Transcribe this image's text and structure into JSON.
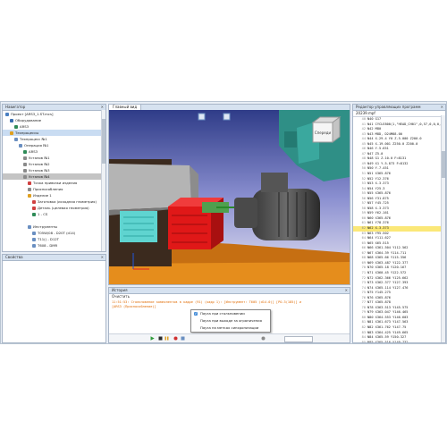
{
  "navigator": {
    "title": "Навигатор",
    "items": [
      {
        "label": "Проект [ARS3_1.ST.mcs]",
        "indent": 0,
        "icon": "#4a7fc1",
        "state": ""
      },
      {
        "label": "Оборудование",
        "indent": 1,
        "icon": "#3a6fb0",
        "state": ""
      },
      {
        "label": "ARS3",
        "indent": 2,
        "icon": "#2e8b57",
        "state": ""
      },
      {
        "label": "Техпроцессы",
        "indent": 1,
        "icon": "#e0a020",
        "state": "sel"
      },
      {
        "label": "Техпроцесс №1",
        "indent": 2,
        "icon": "#6a8fc1",
        "state": ""
      },
      {
        "label": "Операция №1",
        "indent": 3,
        "icon": "#6a8fc1",
        "state": ""
      },
      {
        "label": "ARS3",
        "indent": 4,
        "icon": "#2e8b57",
        "state": ""
      },
      {
        "label": "Установ №1",
        "indent": 4,
        "icon": "#8a8a8a",
        "state": ""
      },
      {
        "label": "Установ №2",
        "indent": 4,
        "icon": "#8a8a8a",
        "state": ""
      },
      {
        "label": "Установ №3",
        "indent": 4,
        "icon": "#8a8a8a",
        "state": ""
      },
      {
        "label": "Установ №4",
        "indent": 4,
        "icon": "#8a8a8a",
        "state": "hl"
      },
      {
        "label": "Точка привязки изделия",
        "indent": 5,
        "icon": "#d04040",
        "state": ""
      },
      {
        "label": "Приспособления",
        "indent": 5,
        "icon": "#8a8a8a",
        "state": ""
      },
      {
        "label": "Изделие 1",
        "indent": 5,
        "icon": "#e0a020",
        "state": ""
      },
      {
        "label": "Заготовка (исходная геометрия)",
        "indent": 6,
        "icon": "#d04040",
        "state": ""
      },
      {
        "label": "Деталь (целевая геометрия)",
        "indent": 6,
        "icon": "#d04040",
        "state": ""
      },
      {
        "label": "1 - CS",
        "indent": 6,
        "icon": "#2e8b57",
        "state": ""
      },
      {
        "label": "",
        "indent": 5,
        "icon": "",
        "state": ""
      },
      {
        "label": "Инструменты",
        "indent": 5,
        "icon": "#6a8fc1",
        "state": ""
      },
      {
        "label": "T05W/08 - D20T (d14)",
        "indent": 6,
        "icon": "#6a8fc1",
        "state": ""
      },
      {
        "label": "T11() - D12T",
        "indent": 6,
        "icon": "#6a8fc1",
        "state": ""
      },
      {
        "label": "T608 - DMR",
        "indent": 6,
        "icon": "#6a8fc1",
        "state": ""
      }
    ]
  },
  "properties": {
    "title": "Свойства"
  },
  "view": {
    "tab_label": "Главный вид",
    "cube_label": "Спереди"
  },
  "history": {
    "title": "История",
    "clear_label": "Очистить",
    "log_lines": [
      "11:51:53: Столкновение компонентов в кадре (91) (кадр 1): [Инструмент: T605 (d14.0)] [PO-3(185)] и",
      "[ARS3 (Приспособление)]"
    ],
    "popup_options": [
      {
        "label": "Пауза при столкновении",
        "checked": true
      },
      {
        "label": "Пауза при выходе за ограничения",
        "checked": false
      },
      {
        "label": "Пауза на метках синхронизации",
        "checked": false
      }
    ]
  },
  "editor": {
    "title": "Редактор управляющих программ",
    "filename": "20239.mpf",
    "current_line": 62,
    "lines": [
      {
        "n": 40,
        "t": "N40 G17"
      },
      {
        "n": 41,
        "t": "N41 CYCLE800(1,\"HEAD_CH01\",0,57,0,0,0,"
      },
      {
        "n": 42,
        "t": "N42 M80"
      },
      {
        "n": 43,
        "t": "N43 M8D, D24M88.00"
      },
      {
        "n": 44,
        "t": "N44 X-29.4 Y0 Z-5.000 Z200.0"
      },
      {
        "n": 45,
        "t": "N45 X-19.001 Z250.0 Z200.0"
      },
      {
        "n": 46,
        "t": "N46 Y-5.651"
      },
      {
        "n": 47,
        "t": "N47 Z5.0"
      },
      {
        "n": 48,
        "t": "N48 G1 Z-10.0 F=8131"
      },
      {
        "n": 49,
        "t": "N49 X1 Y-5.873 F=8132"
      },
      {
        "n": 50,
        "t": "N50 Y-7.451"
      },
      {
        "n": 51,
        "t": "N51 X365.876"
      },
      {
        "n": 52,
        "t": "N52 Y12.376"
      },
      {
        "n": 53,
        "t": "N53 X-3.373"
      },
      {
        "n": 54,
        "t": "N54 Y25.3"
      },
      {
        "n": 55,
        "t": "N55 X365.876"
      },
      {
        "n": 56,
        "t": "N56 Y31.875"
      },
      {
        "n": 57,
        "t": "N57 Y45.725"
      },
      {
        "n": 58,
        "t": "N58 X-3.373"
      },
      {
        "n": 59,
        "t": "N59 Y62.161"
      },
      {
        "n": 60,
        "t": "N60 X365.876"
      },
      {
        "n": 61,
        "t": "N61 Y78.376"
      },
      {
        "n": 62,
        "t": "N62 X-3.373"
      },
      {
        "n": 63,
        "t": "N63 Y95.502"
      },
      {
        "n": 64,
        "t": "N64 Y111.627"
      },
      {
        "n": 65,
        "t": "N65 X65.515"
      },
      {
        "n": 66,
        "t": "N66 X361.504 Y112.562"
      },
      {
        "n": 67,
        "t": "N67 X364.39 Y114.711"
      },
      {
        "n": 68,
        "t": "N68 X365.66 Y115.356"
      },
      {
        "n": 69,
        "t": "N69 X363.487 Y122.377"
      },
      {
        "n": 70,
        "t": "N70 X365.18 Y120.167"
      },
      {
        "n": 71,
        "t": "N71 X360.45 Y122.572"
      },
      {
        "n": 72,
        "t": "N72 X362.366 Y125.662"
      },
      {
        "n": 73,
        "t": "N73 X362.377 Y127.393"
      },
      {
        "n": 74,
        "t": "N74 X365.114 Y127.476"
      },
      {
        "n": 75,
        "t": "N75 Y145.275"
      },
      {
        "n": 76,
        "t": "N76 X365.876"
      },
      {
        "n": 77,
        "t": "N77 X365.878"
      },
      {
        "n": 78,
        "t": "N78 X363.513 Y145.575"
      },
      {
        "n": 79,
        "t": "N79 X363.047 Y146.465"
      },
      {
        "n": 80,
        "t": "N80 X364.553 Y146.603"
      },
      {
        "n": 81,
        "t": "N81 X361.673 Y147.563"
      },
      {
        "n": 82,
        "t": "N82 X361.762 Y147.75"
      },
      {
        "n": 83,
        "t": "N83 X364.425 Y149.665"
      },
      {
        "n": 84,
        "t": "N84 X365.59 Y150.327"
      },
      {
        "n": 85,
        "t": "N85 X365.516 Y149.732"
      }
    ]
  },
  "colors": {
    "spindle": "#2f8f86",
    "vise_red": "#e01818",
    "vise_cyan": "#5fd4d0",
    "floor": "#e58d1c",
    "highlight": "#fbe878"
  },
  "icons": [
    "home-icon",
    "view-cube-icon",
    "play-icon",
    "stop-icon",
    "pause-icon",
    "step-icon"
  ]
}
